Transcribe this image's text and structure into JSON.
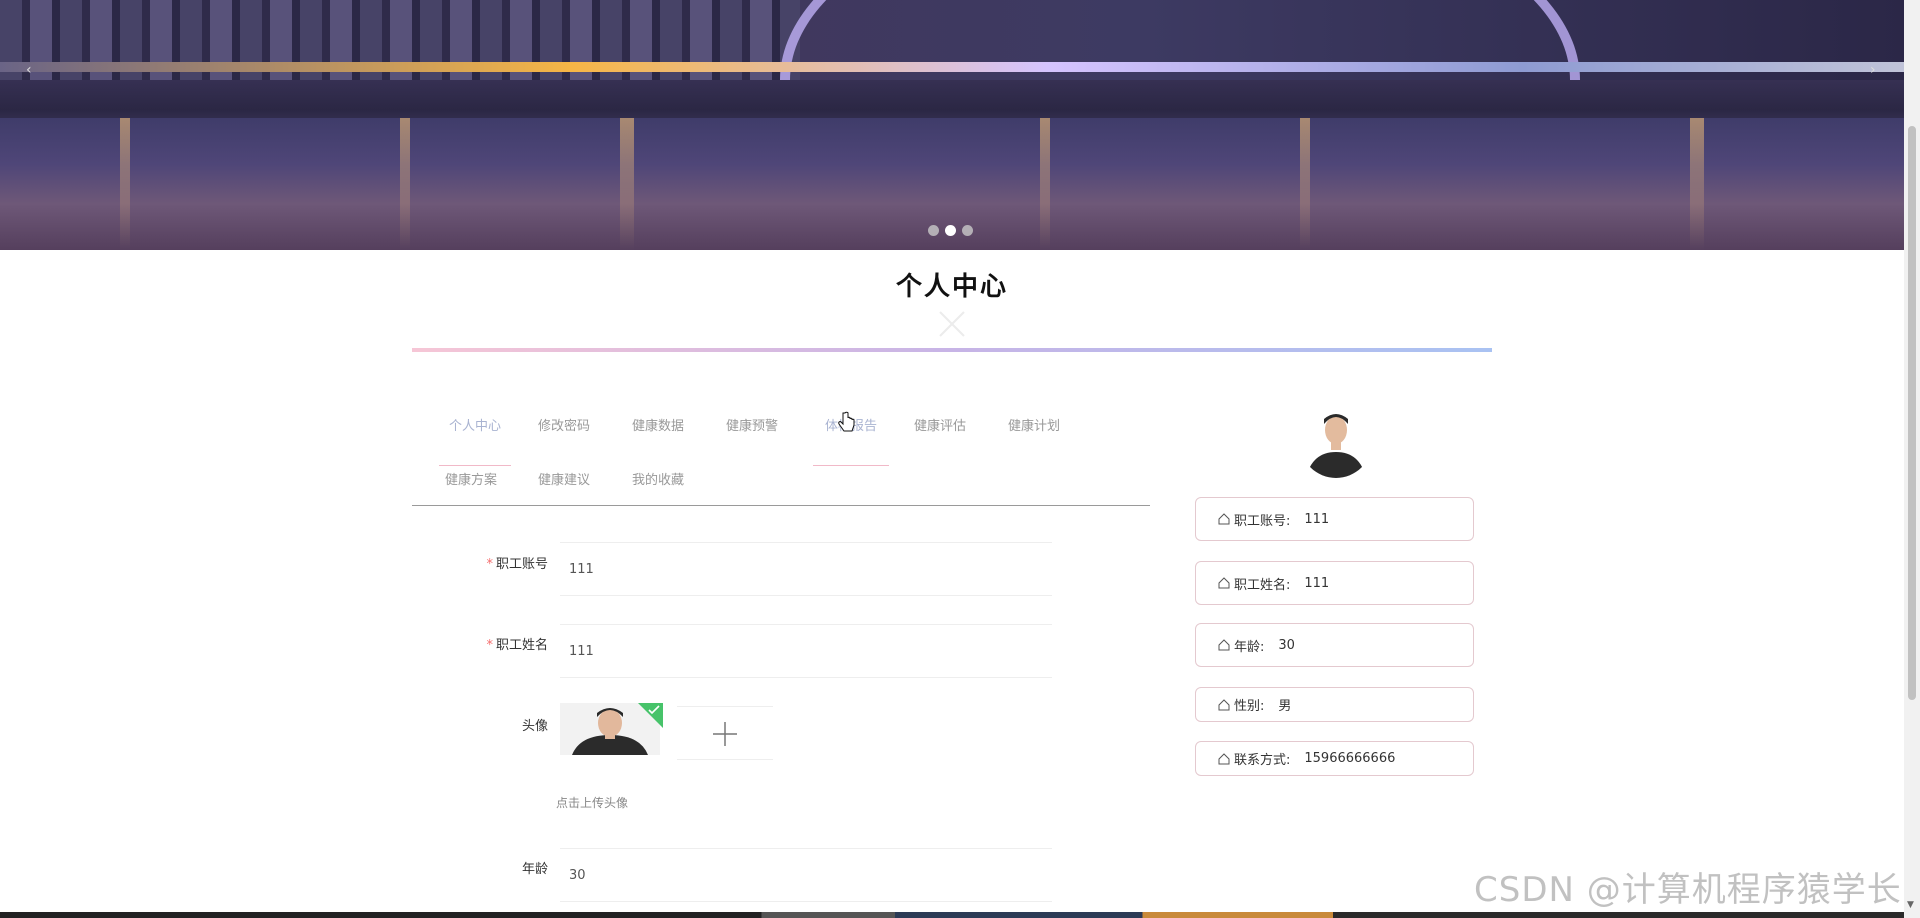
{
  "page": {
    "title": "个人中心"
  },
  "banner": {
    "prev_arrow": "‹",
    "next_arrow": "›",
    "dots": 3,
    "active_dot": 1
  },
  "tabs": [
    {
      "label": "个人中心",
      "state": "active"
    },
    {
      "label": "修改密码"
    },
    {
      "label": "健康数据"
    },
    {
      "label": "健康预警"
    },
    {
      "label": "体检报告",
      "state": "hover"
    },
    {
      "label": "健康评估"
    },
    {
      "label": "健康计划"
    },
    {
      "label": "健康方案"
    },
    {
      "label": "健康建议"
    },
    {
      "label": "我的收藏"
    }
  ],
  "form": {
    "account_label": "职工账号",
    "account_value": "111",
    "name_label": "职工姓名",
    "name_value": "111",
    "avatar_label": "头像",
    "upload_hint": "点击上传头像",
    "age_label": "年龄",
    "age_value": "30",
    "required_mark": "*"
  },
  "profile": {
    "items": [
      {
        "label": "职工账号:",
        "value": "111"
      },
      {
        "label": "职工姓名:",
        "value": "111"
      },
      {
        "label": "年龄:",
        "value": "30"
      },
      {
        "label": "性别:",
        "value": "男"
      },
      {
        "label": "联系方式:",
        "value": "15966666666"
      }
    ]
  },
  "watermark": "CSDN @计算机程序猿学长",
  "colors": {
    "accent": "#a9b3d1",
    "required": "#f56c6c",
    "upload_ok": "#47c36a",
    "divider_start": "#f6c6d6",
    "divider_end": "#a9c2f2"
  }
}
